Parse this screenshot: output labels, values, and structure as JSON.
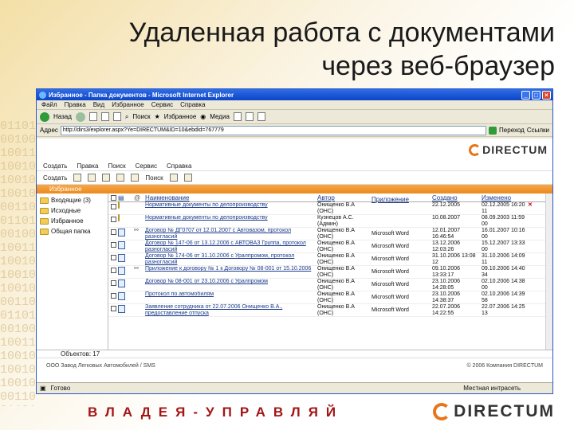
{
  "slide": {
    "title_line1": "Удаленная работа с документами",
    "title_line2": "через  веб-браузер",
    "tagline": "ВЛАДЕЯ-УПРАВЛЯЙ",
    "bottom_logo": "DIRECTUM",
    "colors": {
      "accent": "#e8751a",
      "tagline": "#a31515",
      "titlebar": "#0c45c8"
    }
  },
  "browser": {
    "title": "Избранное - Папка документов - Microsoft Internet Explorer",
    "menu": [
      "Файл",
      "Правка",
      "Вид",
      "Избранное",
      "Сервис",
      "Справка"
    ],
    "toolbar": {
      "back": "Назад",
      "search": "Поиск",
      "favorites": "Избранное",
      "media": "Медиа"
    },
    "address_label": "Адрес",
    "address_value": "http://dirs3/explorer.aspx?Ye=DIRECTUM&ID=10&ebdid=767779",
    "go": "Переход",
    "links": "Ссылки",
    "status_left": "Готово",
    "status_zone": "Местная интрасеть"
  },
  "app": {
    "logo": "DIRECTUM",
    "menu": [
      "Создать",
      "Правка",
      "Поиск",
      "Сервис",
      "Справка"
    ],
    "toolbar": [
      "Создать",
      "Поиск"
    ],
    "section": "Избранное",
    "tree": [
      "Входящие (3)",
      "Исходные",
      "Избранное",
      "Общая папка"
    ],
    "headers": {
      "name": "Наименование",
      "author": "Автор",
      "app": "Приложение",
      "created": "Создано",
      "modified": "Изменено"
    },
    "rows": [
      {
        "name": "Нормативные документы по делопроизводству",
        "author": "Онищенко В.А (ОНС)",
        "app": "",
        "created": "22.12.2005",
        "modified": "02.12.2005 16:20 11"
      },
      {
        "name": "Нормативные документы по делопроизводству",
        "author": "Кузнецов А.С. (Админ)",
        "app": "",
        "created": "10.08.2007",
        "modified": "08.09.2003 11:59 00"
      },
      {
        "name": "Договор № ДГ0707 от 12.01.2007 с Автовазом, протокол разногласий",
        "author": "Онищенко В.А (ОНС)",
        "app": "Microsoft Word",
        "created": "12.01.2007 16:46:54",
        "modified": "16.01.2007 10:16 00"
      },
      {
        "name": "Договор № 147-06 от 13.12.2006 с АВТОВАЗ Группа, протокол разногласий",
        "author": "Онищенко В.А (ОНС)",
        "app": "Microsoft Word",
        "created": "13.12.2006 12:03:26",
        "modified": "15.12.2007 13:33 00"
      },
      {
        "name": "Договор № 174-06 от 31.10.2006 с Уралпромом, протокол разногласий",
        "author": "Онищенко В.А (ОНС)",
        "app": "Microsoft Word",
        "created": "31.10.2006 13:08 12",
        "modified": "31.10.2006 14:09 11"
      },
      {
        "name": "Приложение к договору № 1 к Договору № 08-001 от 15.10.2006",
        "author": "Онищенко В.А (ОНС)",
        "app": "Microsoft Word",
        "created": "09.10.2006 13:33:17",
        "modified": "09.10.2006 14:40 34"
      },
      {
        "name": "Договор № 08-001 от 23.10.2006 с Уралпромом",
        "author": "Онищенко В.А (ОНС)",
        "app": "Microsoft Word",
        "created": "23.10.2006 14:28:05",
        "modified": "02.10.2006 14:38 00"
      },
      {
        "name": "Протокол по автомобилям",
        "author": "Онищенко В.А (ОНС)",
        "app": "Microsoft Word",
        "created": "23.10.2006 14:38:37",
        "modified": "02.10.2006 14:39 58"
      },
      {
        "name": "Заявление сотрудника от 22.07.2006 Онищенко В.А., предоставление отпуска",
        "author": "Онищенко В.А (ОНС)",
        "app": "Microsoft Word",
        "created": "22.07.2006 14:22:55",
        "modified": "22.07.2006 14:25 13"
      }
    ],
    "count": "Объектов: 17",
    "footer_left": "ООО Завод Легковых Автомобилей / SMS",
    "footer_right": "© 2006 Компания DIRECTUM"
  }
}
